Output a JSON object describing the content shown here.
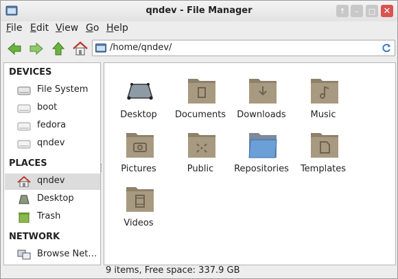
{
  "window": {
    "title": "qndev - File Manager"
  },
  "menu": [
    "File",
    "Edit",
    "View",
    "Go",
    "Help"
  ],
  "address": {
    "path": "/home/qndev/"
  },
  "sidebar": {
    "devices_heading": "DEVICES",
    "devices": [
      {
        "label": "File System",
        "icon": "harddisk-icon"
      },
      {
        "label": "boot",
        "icon": "drive-icon"
      },
      {
        "label": "fedora",
        "icon": "drive-icon"
      },
      {
        "label": "qndev",
        "icon": "drive-icon"
      }
    ],
    "places_heading": "PLACES",
    "places": [
      {
        "label": "qndev",
        "icon": "home-icon",
        "selected": true
      },
      {
        "label": "Desktop",
        "icon": "desktop-icon"
      },
      {
        "label": "Trash",
        "icon": "trash-icon"
      }
    ],
    "network_heading": "NETWORK",
    "network": [
      {
        "label": "Browse Network",
        "icon": "network-icon"
      }
    ]
  },
  "files": [
    {
      "name": "Desktop",
      "icon": "desktop-folder-icon"
    },
    {
      "name": "Documents",
      "icon": "documents-folder-icon"
    },
    {
      "name": "Downloads",
      "icon": "downloads-folder-icon"
    },
    {
      "name": "Music",
      "icon": "music-folder-icon"
    },
    {
      "name": "Pictures",
      "icon": "pictures-folder-icon"
    },
    {
      "name": "Public",
      "icon": "public-folder-icon"
    },
    {
      "name": "Repositories",
      "icon": "blue-folder-icon"
    },
    {
      "name": "Templates",
      "icon": "templates-folder-icon"
    },
    {
      "name": "Videos",
      "icon": "videos-folder-icon"
    }
  ],
  "status": "9 items, Free space: 337.9 GB",
  "colors": {
    "folder": "#a89a80",
    "folder_dark": "#8e816b",
    "selection": "#dcdcdc",
    "close": "#d9534f",
    "arrow_green": "#5aa52b"
  }
}
